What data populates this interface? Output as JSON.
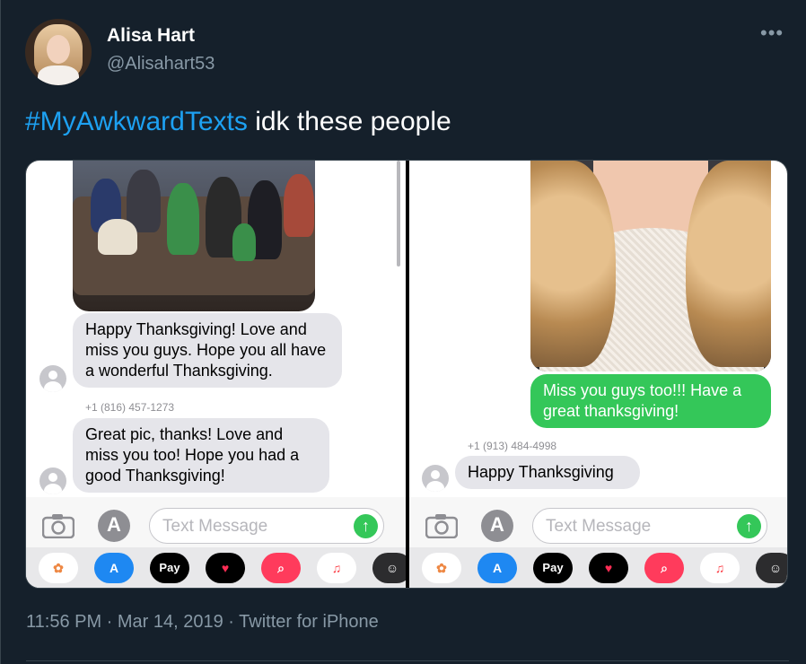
{
  "tweet": {
    "display_name": "Alisa Hart",
    "handle": "@Alisahart53",
    "hashtag": "#MyAwkwardTexts",
    "text": " idk these people",
    "timestamp": "11:56 PM · Mar 14, 2019 · Twitter for iPhone"
  },
  "left_screenshot": {
    "bubble_1": "Happy Thanksgiving! Love and miss you guys. Hope you all have a wonderful Thanksgiving.",
    "sender_2": "+1 (816) 457-1273",
    "bubble_2": "Great pic, thanks!  Love and miss you too!  Hope you had a good Thanksgiving!",
    "input_placeholder": "Text Message"
  },
  "right_screenshot": {
    "bubble_1": "Miss you guys too!!! Have a great thanksgiving!",
    "sender_2": "+1 (913) 484-4998",
    "bubble_2": "Happy Thanksgiving",
    "input_placeholder": "Text Message"
  },
  "app_tray": [
    "photos-app",
    "app-store",
    "apple-pay",
    "digital-touch",
    "images-search",
    "music-app",
    "game-app"
  ],
  "apple_pay_label": "Pay",
  "colors": {
    "background": "#15202b",
    "hashtag": "#1da1f2",
    "imessage_green": "#34c759",
    "bubble_gray": "#e5e5ea"
  }
}
